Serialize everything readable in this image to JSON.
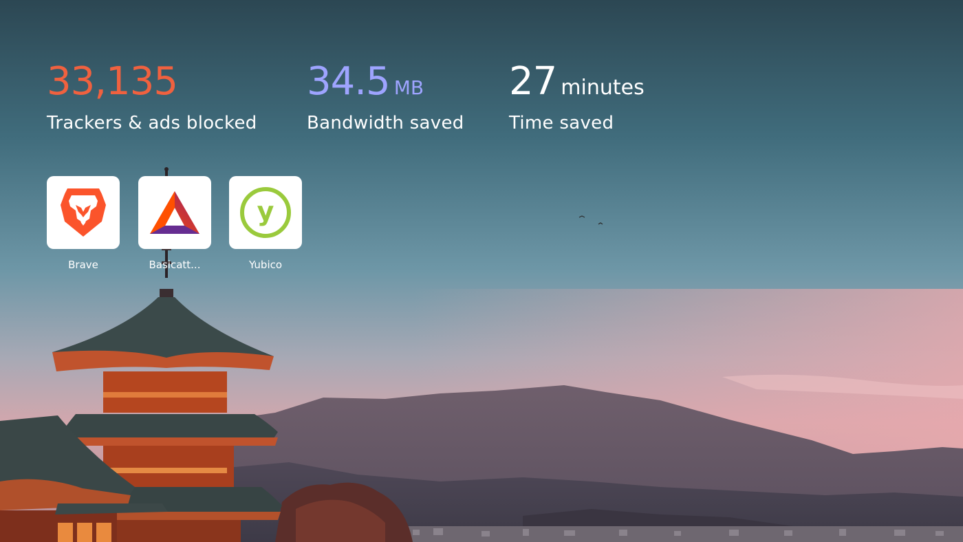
{
  "stats": {
    "trackers": {
      "value": "33,135",
      "unit": "",
      "label": "Trackers & ads blocked",
      "color": "#f0613f"
    },
    "bandwidth": {
      "value": "34.5",
      "unit": "MB",
      "label": "Bandwidth saved",
      "color": "#9ea4ff"
    },
    "time": {
      "value": "27",
      "unit": "minutes",
      "label": "Time saved",
      "color": "#ffffff"
    }
  },
  "top_sites": [
    {
      "label": "Brave",
      "icon": "brave-lion-icon",
      "color": "#fb542b"
    },
    {
      "label": "Basicatt...",
      "icon": "basic-attention-token-icon",
      "color": "#662d91"
    },
    {
      "label": "Yubico",
      "icon": "yubico-icon",
      "color": "#9aca3c"
    }
  ],
  "background": {
    "scene": "pagoda-sunset-icon"
  }
}
